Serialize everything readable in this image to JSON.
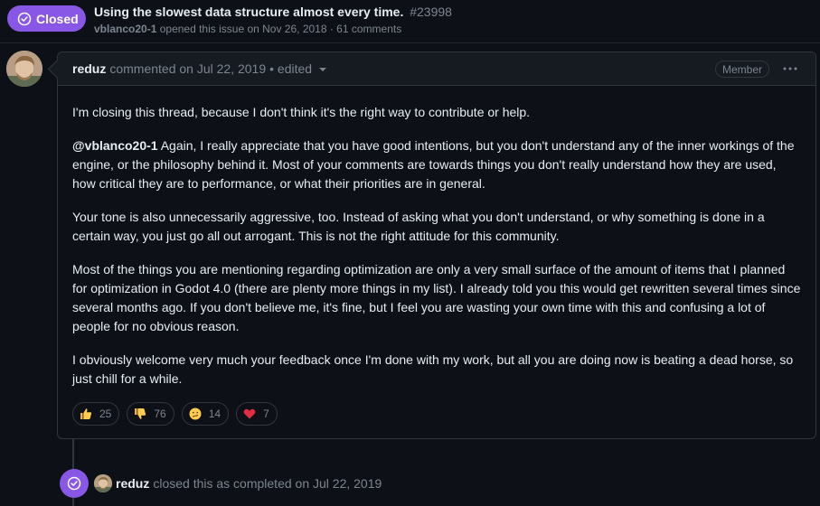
{
  "header": {
    "state_label": "Closed",
    "state_icon": "issue-closed-icon",
    "title": "Using the slowest data structure almost every time.",
    "number": "#23998",
    "opened_by": "vblanco20-1",
    "opened_text": "opened this issue on Nov 26, 2018 · 61 comments"
  },
  "comment": {
    "author": "reduz",
    "action_text": "commented on Jul 22, 2019",
    "edited_text": "• edited",
    "role_badge": "Member",
    "body": {
      "p1": "I'm closing this thread, because I don't think it's the right way to contribute or help.",
      "p2_mention": "@vblanco20-1",
      "p2_text": " Again, I really appreciate that you have good intentions, but you don't understand any of the inner workings of the engine, or the philosophy behind it. Most of your comments are towards things you don't really understand how they are used, how critical they are to performance, or what their priorities are in general.",
      "p3": "Your tone is also unnecessarily aggressive, too. Instead of asking what you don't understand, or why something is done in a certain way, you just go all out arrogant. This is not the right attitude for this community.",
      "p4": "Most of the things you are mentioning regarding optimization are only a very small surface of the amount of items that I planned for optimization in Godot 4.0 (there are plenty more things in my list). I already told you this would get rewritten several times since several months ago. If you don't believe me, it's fine, but I feel you are wasting your own time with this and confusing a lot of people for no obvious reason.",
      "p5": "I obviously welcome very much your feedback once I'm done with my work, but all you are doing now is beating a dead horse, so just chill for a while."
    },
    "reactions": [
      {
        "icon": "thumbs-up-icon",
        "count": "25"
      },
      {
        "icon": "thumbs-down-icon",
        "count": "76"
      },
      {
        "icon": "confused-icon",
        "count": "14"
      },
      {
        "icon": "heart-icon",
        "count": "7"
      }
    ]
  },
  "event": {
    "icon": "issue-closed-icon",
    "actor": "reduz",
    "text": "closed this as completed on Jul 22, 2019"
  },
  "colors": {
    "background": "#0d1117",
    "closed_purple": "#8957e5",
    "border": "#30363d",
    "muted_text": "#7d8590",
    "text": "#e6edf3"
  }
}
